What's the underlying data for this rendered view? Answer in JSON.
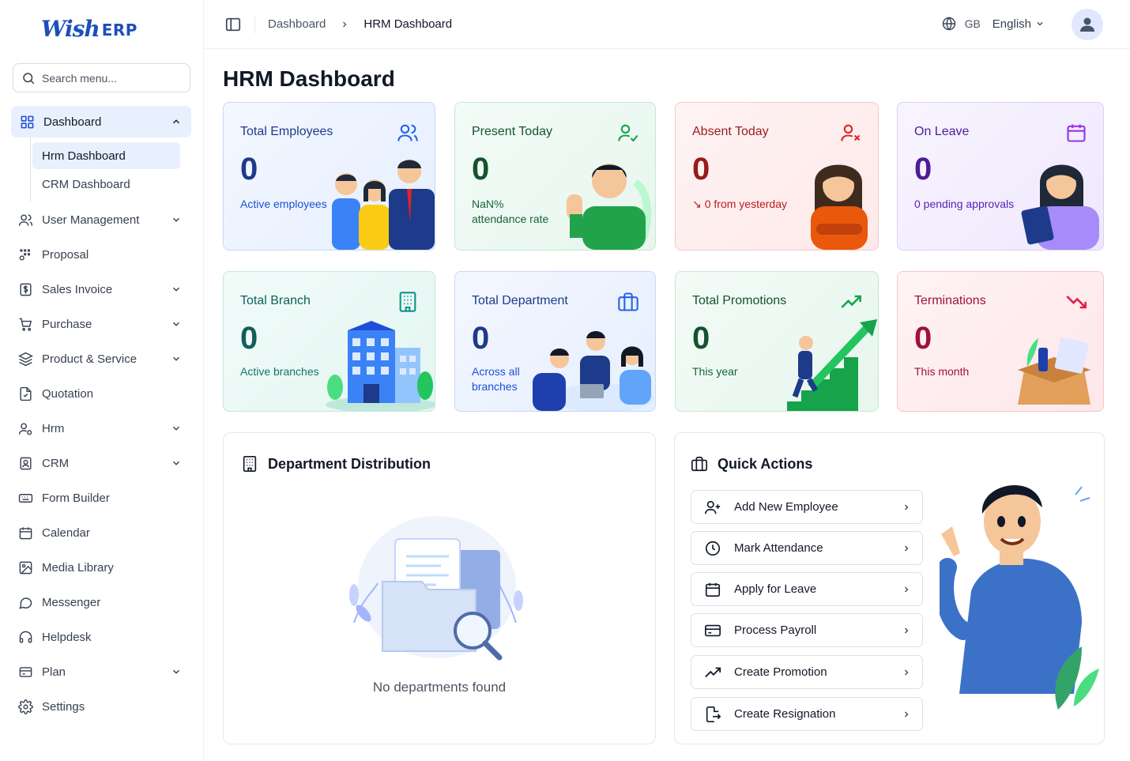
{
  "app": {
    "logo_main": "Wish",
    "logo_suffix": "ERP"
  },
  "search": {
    "placeholder": "Search menu..."
  },
  "sidebar": {
    "items": [
      {
        "label": "Dashboard",
        "icon": "grid-icon",
        "expanded": true,
        "children": [
          "Hrm Dashboard",
          "CRM Dashboard"
        ]
      },
      {
        "label": "User Management",
        "icon": "users-icon",
        "has_children": true
      },
      {
        "label": "Proposal",
        "icon": "proposal-icon"
      },
      {
        "label": "Sales Invoice",
        "icon": "invoice-icon",
        "has_children": true
      },
      {
        "label": "Purchase",
        "icon": "cart-icon",
        "has_children": true
      },
      {
        "label": "Product & Service",
        "icon": "layers-icon",
        "has_children": true
      },
      {
        "label": "Quotation",
        "icon": "quotation-icon"
      },
      {
        "label": "Hrm",
        "icon": "hrm-icon",
        "has_children": true
      },
      {
        "label": "CRM",
        "icon": "crm-icon",
        "has_children": true
      },
      {
        "label": "Form Builder",
        "icon": "form-icon"
      },
      {
        "label": "Calendar",
        "icon": "calendar-icon"
      },
      {
        "label": "Media Library",
        "icon": "image-icon"
      },
      {
        "label": "Messenger",
        "icon": "chat-icon"
      },
      {
        "label": "Helpdesk",
        "icon": "headset-icon"
      },
      {
        "label": "Plan",
        "icon": "plan-icon",
        "has_children": true
      },
      {
        "label": "Settings",
        "icon": "gear-icon"
      }
    ]
  },
  "topbar": {
    "breadcrumb": [
      "Dashboard",
      "HRM Dashboard"
    ],
    "region": "GB",
    "language": "English"
  },
  "page": {
    "title": "HRM Dashboard"
  },
  "stats": [
    {
      "label": "Total Employees",
      "value": "0",
      "sub": "Active employees",
      "icon": "users-icon",
      "theme": "blue"
    },
    {
      "label": "Present Today",
      "value": "0",
      "sub": "NaN%",
      "sub2": "attendance rate",
      "icon": "user-check-icon",
      "theme": "green"
    },
    {
      "label": "Absent Today",
      "value": "0",
      "sub": "0 from yesterday",
      "icon": "user-x-icon",
      "theme": "red"
    },
    {
      "label": "On Leave",
      "value": "0",
      "sub": "0 pending approvals",
      "icon": "calendar-icon",
      "theme": "purple"
    },
    {
      "label": "Total Branch",
      "value": "0",
      "sub": "Active branches",
      "icon": "building-icon",
      "theme": "teal"
    },
    {
      "label": "Total Department",
      "value": "0",
      "sub": "Across all",
      "sub2": "branches",
      "icon": "briefcase-icon",
      "theme": "blue"
    },
    {
      "label": "Total Promotions",
      "value": "0",
      "sub": "This year",
      "icon": "trending-up-icon",
      "theme": "green"
    },
    {
      "label": "Terminations",
      "value": "0",
      "sub": "This month",
      "icon": "trending-down-icon",
      "theme": "pink"
    }
  ],
  "dept": {
    "title": "Department Distribution",
    "empty": "No departments found"
  },
  "quick": {
    "title": "Quick Actions",
    "actions": [
      {
        "label": "Add New Employee",
        "icon": "user-plus-icon"
      },
      {
        "label": "Mark Attendance",
        "icon": "clock-icon"
      },
      {
        "label": "Apply for Leave",
        "icon": "calendar-icon"
      },
      {
        "label": "Process Payroll",
        "icon": "credit-card-icon"
      },
      {
        "label": "Create Promotion",
        "icon": "trending-up-icon"
      },
      {
        "label": "Create Resignation",
        "icon": "file-export-icon"
      }
    ]
  },
  "colors": {
    "brand": "#1e4fb8",
    "active_bg": "#e8f0fe",
    "blue": "#2563eb",
    "green": "#16a34a",
    "red": "#dc2626",
    "purple": "#7c3aed",
    "teal": "#0f766e",
    "pink": "#e11d48"
  }
}
